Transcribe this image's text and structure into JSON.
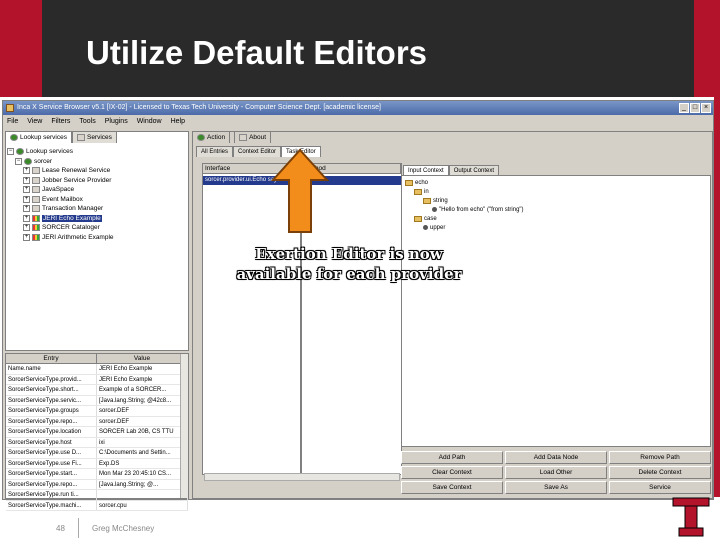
{
  "slide": {
    "title": "Utilize Default Editors",
    "page_number": "48",
    "author": "Greg McChesney",
    "callout": "Exertion Editor is now available for each provider",
    "accent_color": "#b3142b"
  },
  "window": {
    "title": "Inca X Service Browser v5.1 [IX-02] - Licensed to Texas Tech University - Computer Science Dept. [academic license]",
    "menu": [
      "File",
      "View",
      "Filters",
      "Tools",
      "Plugins",
      "Window",
      "Help"
    ]
  },
  "left_tabs": [
    "Lookup services",
    "Services"
  ],
  "tree": {
    "root": "Lookup services",
    "group": "sorcer",
    "items": [
      "Lease Renewal Service",
      "Jobber Service Provider",
      "JavaSpace",
      "Event Mailbox",
      "Transaction Manager",
      "JERI Echo Example",
      "SORCER Cataloger",
      "JERI Arithmetic Example"
    ]
  },
  "properties": {
    "headers": [
      "Entry",
      "Value"
    ],
    "rows": [
      [
        "Name.name",
        "JERI Echo Example"
      ],
      [
        "SorcerServiceType.provid...",
        "JERI Echo Example"
      ],
      [
        "SorcerServiceType.short...",
        "Example of a SORCER..."
      ],
      [
        "SorcerServiceType.servic...",
        "[Java.lang.String; @42c8..."
      ],
      [
        "SorcerServiceType.groups",
        "sorcer.DEF"
      ],
      [
        "SorcerServiceType.repo...",
        "sorcer.DEF"
      ],
      [
        "SorcerServiceType.location",
        "SORCER Lab 20B, CS TTU"
      ],
      [
        "SorcerServiceType.host",
        "ixi"
      ],
      [
        "SorcerServiceType.use D...",
        "C:\\Documents and Settin..."
      ],
      [
        "SorcerServiceType.use Fi...",
        "Exp.DS"
      ],
      [
        "SorcerServiceType.start...",
        "Mon Mar 23 20:45:10 CS..."
      ],
      [
        "SorcerServiceType.repo...",
        "[Java.lang.String; @..."
      ],
      [
        "SorcerServiceType.run ti...",
        ""
      ],
      [
        "SorcerServiceType.machi...",
        "sorcer.cpu"
      ]
    ]
  },
  "toolbar": {
    "action_label": "Action",
    "about_label": "About"
  },
  "sub_tabs": [
    "All Entries",
    "Context Editor",
    "Task Editor"
  ],
  "interface": {
    "headers": [
      "Interface",
      "Method"
    ],
    "selected_row": "sorcer.provider.ui.Echo  sayHello"
  },
  "context_tabs": [
    "Input Context",
    "Output Context"
  ],
  "context_tree": [
    {
      "label": "echo",
      "depth": 0,
      "kind": "folder"
    },
    {
      "label": "in",
      "depth": 1,
      "kind": "folder"
    },
    {
      "label": "string",
      "depth": 2,
      "kind": "folder"
    },
    {
      "label": "\"Hello from echo\" (\"from string\")",
      "depth": 3,
      "kind": "leaf"
    },
    {
      "label": "case",
      "depth": 1,
      "kind": "folder"
    },
    {
      "label": "upper",
      "depth": 2,
      "kind": "leaf"
    }
  ],
  "buttons": [
    "Add Path",
    "Add Data Node",
    "Remove Path",
    "Clear Context",
    "Load Other",
    "Delete Context",
    "Save Context",
    "Save As",
    "Service"
  ]
}
